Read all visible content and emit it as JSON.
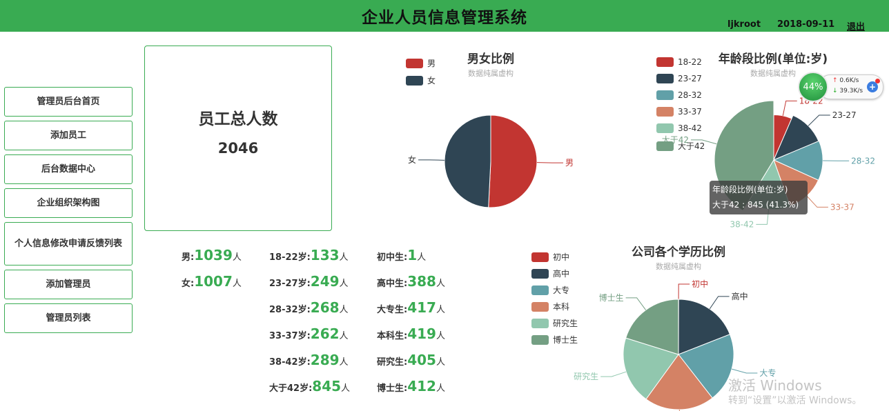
{
  "header": {
    "title": "企业人员信息管理系统",
    "user": "ljkroot",
    "date": "2018-09-11",
    "logout": "退出"
  },
  "sidebar": {
    "items": [
      {
        "label": "管理员后台首页"
      },
      {
        "label": "添加员工"
      },
      {
        "label": "后台数据中心"
      },
      {
        "label": "企业组织架构图"
      },
      {
        "label": "个人信息修改申请反馈列表"
      },
      {
        "label": "添加管理员"
      },
      {
        "label": "管理员列表"
      }
    ]
  },
  "total": {
    "label": "员工总人数",
    "value": "2046"
  },
  "stats": {
    "unit": "人",
    "gender": [
      {
        "label": "男:",
        "value": "1039"
      },
      {
        "label": "女:",
        "value": "1007"
      }
    ],
    "age": [
      {
        "label": "18-22岁:",
        "value": "133"
      },
      {
        "label": "23-27岁:",
        "value": "249"
      },
      {
        "label": "28-32岁:",
        "value": "268"
      },
      {
        "label": "33-37岁:",
        "value": "262"
      },
      {
        "label": "38-42岁:",
        "value": "289"
      },
      {
        "label": "大于42岁:",
        "value": "845"
      }
    ],
    "education": [
      {
        "label": "初中生:",
        "value": "1"
      },
      {
        "label": "高中生:",
        "value": "388"
      },
      {
        "label": "大专生:",
        "value": "417"
      },
      {
        "label": "本科生:",
        "value": "419"
      },
      {
        "label": "研究生:",
        "value": "405"
      },
      {
        "label": "博士生:",
        "value": "412"
      }
    ]
  },
  "colors": {
    "accent": "#39ab52",
    "palette": [
      "#c23531",
      "#2f4554",
      "#61a0a8",
      "#d48265",
      "#91c7ae",
      "#749f83"
    ]
  },
  "chart_data": [
    {
      "type": "pie",
      "title": "男女比例",
      "subtitle": "数据纯属虚构",
      "legend_position": "top-left",
      "categories": [
        "男",
        "女"
      ],
      "values": [
        1039,
        1007
      ]
    },
    {
      "type": "pie",
      "title": "年龄段比例(单位:岁)",
      "subtitle": "数据纯属虚构",
      "legend_position": "left",
      "categories": [
        "18-22",
        "23-27",
        "28-32",
        "33-37",
        "38-42",
        "大于42"
      ],
      "values": [
        133,
        249,
        268,
        262,
        289,
        845
      ],
      "tooltip": {
        "title": "年龄段比例(单位:岁)",
        "text": "大于42 : 845 (41.3%)"
      }
    },
    {
      "type": "pie",
      "title": "公司各个学历比例",
      "subtitle": "数据纯属虚构",
      "legend_position": "left",
      "categories": [
        "初中",
        "高中",
        "大专",
        "本科",
        "研究生",
        "博士生"
      ],
      "values": [
        1,
        388,
        417,
        419,
        405,
        412
      ]
    }
  ],
  "net_widget": {
    "percent": "44%",
    "up": "0.6K/s",
    "down": "39.3K/s"
  },
  "watermark": {
    "line1": "激活 Windows",
    "line2": "转到“设置”以激活 Windows。"
  }
}
